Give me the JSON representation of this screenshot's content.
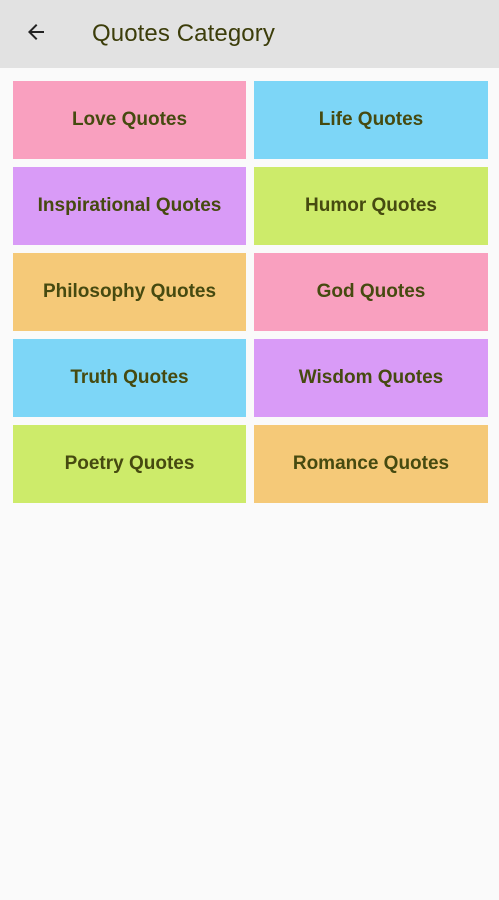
{
  "app_bar": {
    "title": "Quotes Category",
    "back_icon": "arrow-left-icon",
    "background": "#e2e2e2",
    "title_color": "#3c3d0a"
  },
  "categories": [
    {
      "label": "Love Quotes",
      "color": "#f9a0bf"
    },
    {
      "label": "Life Quotes",
      "color": "#7dd6f7"
    },
    {
      "label": "Inspirational Quotes",
      "color": "#d99bf7"
    },
    {
      "label": "Humor Quotes",
      "color": "#cdeb6a"
    },
    {
      "label": "Philosophy Quotes",
      "color": "#f5c978"
    },
    {
      "label": "God Quotes",
      "color": "#f9a0bf"
    },
    {
      "label": "Truth Quotes",
      "color": "#7dd6f7"
    },
    {
      "label": "Wisdom Quotes",
      "color": "#d99bf7"
    },
    {
      "label": "Poetry Quotes",
      "color": "#cdeb6a"
    },
    {
      "label": "Romance Quotes",
      "color": "#f5c978"
    }
  ],
  "tile_text_color": "#464a10"
}
